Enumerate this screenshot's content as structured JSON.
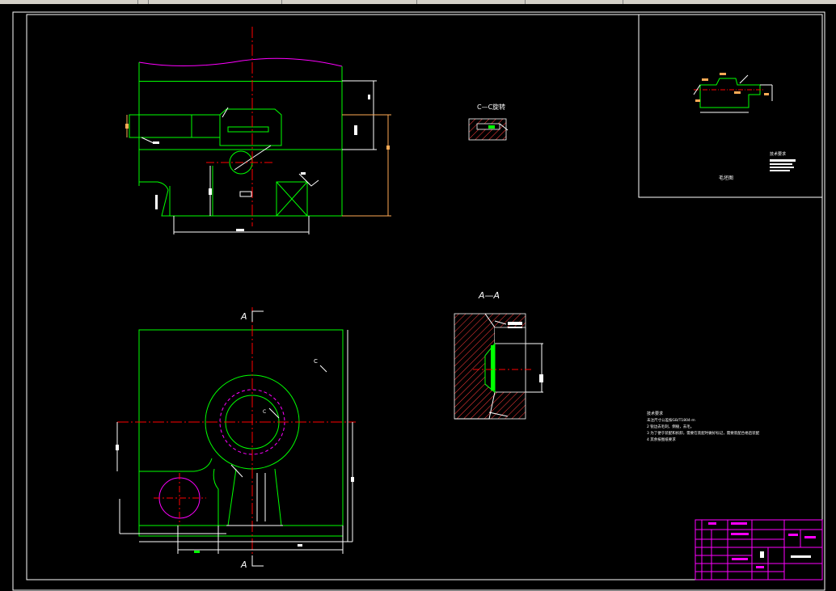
{
  "window": {
    "toolbar_separators": 6
  },
  "colors": {
    "background": "#000000",
    "frame": "#ffffff",
    "outline": "#00ff00",
    "center_line": "#ff0000",
    "dimension": "#ffffff",
    "magenta": "#ff00ff",
    "hatch": "#ff3b3b",
    "orange": "#ffaa55",
    "title_block": "#ff00ff"
  },
  "views": {
    "section_cc_label": "C—C旋转",
    "section_aa_label": "A—A",
    "section_marker_left": "A",
    "section_marker_bottom": "A",
    "detail_marker_c1": "C",
    "detail_marker_c2": "C"
  },
  "blank_view": {
    "caption": "毛坯图",
    "tech_heading": "技术要求"
  },
  "notes": {
    "heading": "技术要求",
    "line1": "未注尺寸公差按GB/T1804-m",
    "line2": "2 锐边去毛刺，倒棱，去毛。",
    "line3": "3 为了便于装配和拆卸，需要在装配时做好标记，需要装配合格后装配",
    "line4": "4 其余按图纸要求"
  },
  "icons": [
    "ruler-dimension",
    "section-arrow",
    "center-mark"
  ]
}
